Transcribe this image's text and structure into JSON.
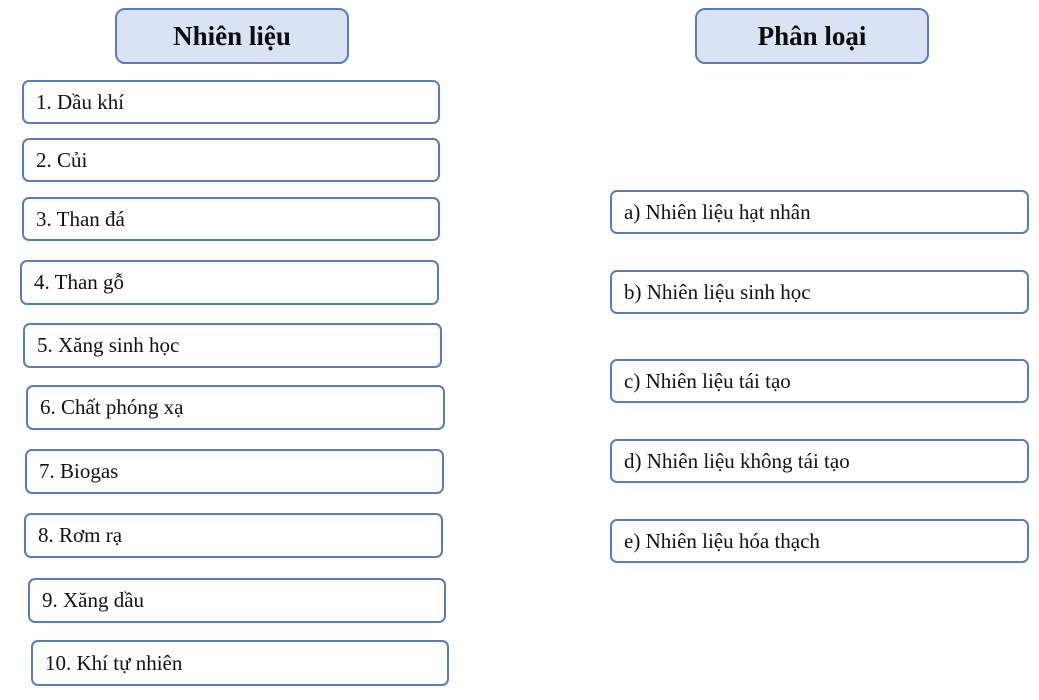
{
  "headers": {
    "left": "Nhiên liệu",
    "right": "Phân loại"
  },
  "fuels": [
    "1. Dầu khí",
    "2. Củi",
    "3. Than đá",
    "4. Than gỗ",
    "5. Xăng sinh học",
    "6. Chất phóng xạ",
    "7. Biogas",
    "8. Rơm rạ",
    "9. Xăng dầu",
    "10. Khí tự nhiên"
  ],
  "categories": [
    "a) Nhiên liệu hạt nhân",
    "b) Nhiên liệu sinh học",
    "c) Nhiên liệu tái tạo",
    "d) Nhiên liệu không tái tạo",
    "e) Nhiên liệu hóa thạch"
  ],
  "colors": {
    "header_fill": "#dae3f3",
    "border": "#5b7db5"
  }
}
